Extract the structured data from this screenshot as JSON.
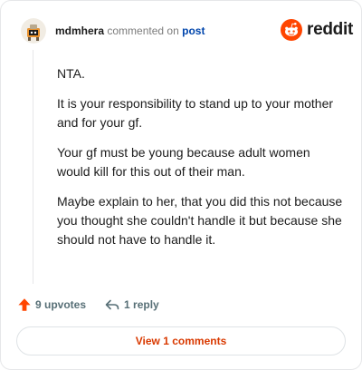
{
  "comment": {
    "username": "mdmhera",
    "verb": "commented on",
    "target_link": "post",
    "paragraphs": [
      "NTA.",
      "It is your responsibility to stand up to your mother and for your gf.",
      "Your gf must be young because adult women would kill for this out of their man.",
      "Maybe explain to her, that you did this not because you thought she couldn't handle it but because she should not have to handle it."
    ]
  },
  "brand": {
    "name": "reddit",
    "accent": "#ff4500"
  },
  "actions": {
    "upvotes": "9 upvotes",
    "replies": "1 reply"
  },
  "footer": {
    "view_button": "View 1 comments"
  },
  "icons": {
    "avatar": "user-avatar",
    "brand": "reddit-snoo-icon",
    "upvote": "upvote-arrow-icon",
    "reply": "reply-arrow-icon"
  },
  "colors": {
    "link": "#0045ac",
    "upvote": "#ff4500",
    "view_button_text": "#d93900",
    "muted": "#576f76"
  }
}
